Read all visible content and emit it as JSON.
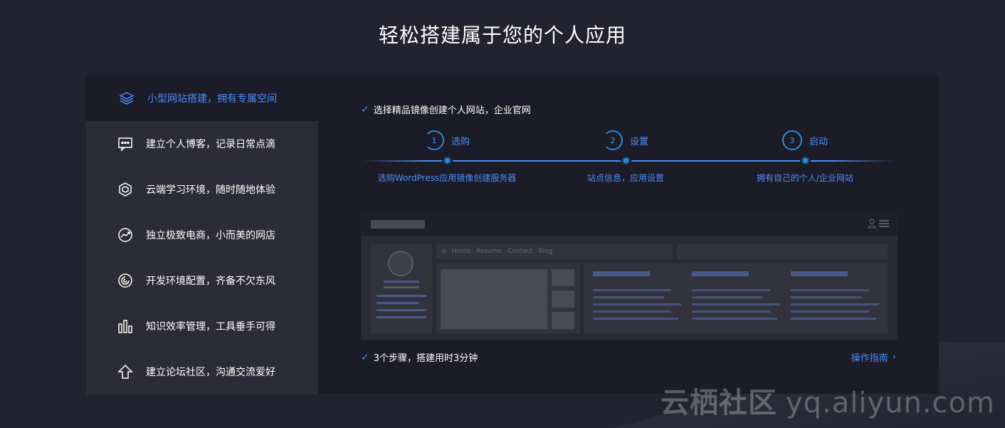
{
  "page_title": "轻松搭建属于您的个人应用",
  "sidebar": {
    "items": [
      {
        "label": "小型网站搭建，拥有专属空间",
        "icon": "layers-icon",
        "active": true
      },
      {
        "label": "建立个人博客，记录日常点滴",
        "icon": "chat-bubble-icon",
        "active": false
      },
      {
        "label": "云端学习环境，随时随地体验",
        "icon": "hexagon-cube-icon",
        "active": false
      },
      {
        "label": "独立极致电商，小而美的网店",
        "icon": "trend-chart-icon",
        "active": false
      },
      {
        "label": "开发环境配置，齐备不欠东风",
        "icon": "swirl-icon",
        "active": false
      },
      {
        "label": "知识效率管理，工具垂手可得",
        "icon": "bar-chart-icon",
        "active": false
      },
      {
        "label": "建立论坛社区，沟通交流爱好",
        "icon": "arrow-up-icon",
        "active": false
      }
    ]
  },
  "content": {
    "headline": "选择精品镜像创建个人网站，企业官网",
    "steps": [
      {
        "num": "1",
        "name": "选购",
        "desc": "选购WordPress应用镜像创建服务器"
      },
      {
        "num": "2",
        "name": "设置",
        "desc": "站点信息，应用设置"
      },
      {
        "num": "3",
        "name": "启动",
        "desc": "拥有自己的个人/企业网站"
      }
    ],
    "mock_nav": [
      "Home",
      "Resume",
      "Contact",
      "Blog"
    ],
    "summary": "3个步骤，搭建用时3分钟",
    "guide_link": "操作指南"
  },
  "watermark": {
    "brand": "云栖社区",
    "url": "yq.aliyun.com"
  },
  "colors": {
    "accent": "#4a8cf7",
    "background": "#222230",
    "panel": "#1c1c28",
    "sidebar": "#2c2c38"
  }
}
